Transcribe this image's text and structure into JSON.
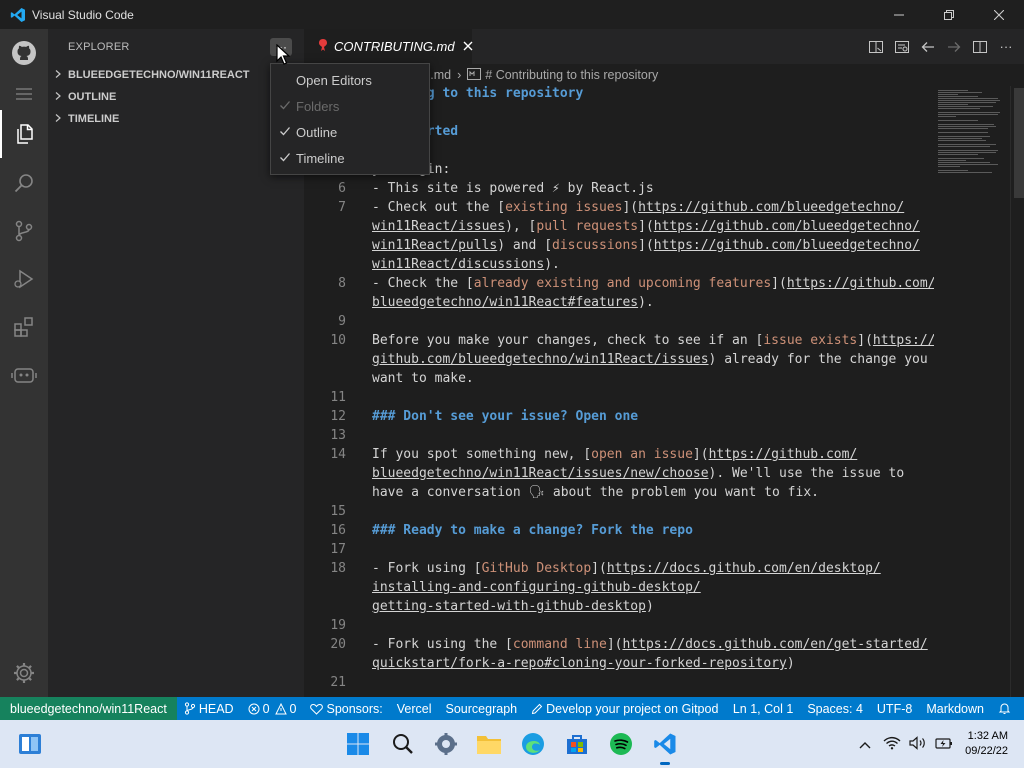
{
  "window": {
    "title": "Visual Studio Code",
    "controls": [
      "minimize",
      "restore",
      "close"
    ]
  },
  "sidebar": {
    "header": "EXPLORER",
    "sections": [
      {
        "label": "BLUEEDGETECHNO/WIN11REACT"
      },
      {
        "label": "OUTLINE"
      },
      {
        "label": "TIMELINE"
      }
    ]
  },
  "context_menu": {
    "items": [
      {
        "label": "Open Editors",
        "checked": false,
        "enabled": true
      },
      {
        "label": "Folders",
        "checked": true,
        "enabled": false
      },
      {
        "label": "Outline",
        "checked": true,
        "enabled": true
      },
      {
        "label": "Timeline",
        "checked": true,
        "enabled": true
      }
    ]
  },
  "tab": {
    "label": "CONTRIBUTING.md"
  },
  "breadcrumb": {
    "file": "s.md",
    "separator": "›",
    "symbol": "# Contributing to this repository"
  },
  "editor": {
    "lines": [
      {
        "n": "",
        "text": "ributing to this repository"
      },
      {
        "n": "",
        "text": "ing started"
      },
      {
        "n": "",
        "text": "you begin:"
      },
      {
        "n": "6",
        "text": "- This site is powered ⚡ by React.js"
      },
      {
        "n": "7",
        "a": "- Check out the [",
        "b": "existing issues",
        "c": "](",
        "d": "https://github.com/blueedgetechno/",
        "e": ""
      },
      {
        "n": "",
        "a": "",
        "b": "",
        "c": "",
        "d": "win11React/issues",
        "e": "), ["
      },
      {
        "n": "",
        "text": "win11React/pulls) and [discussions](https://github.com/blueedgetechno/"
      },
      {
        "n": "",
        "text": "win11React/discussions)."
      },
      {
        "n": "8",
        "text": "- Check the [already existing and upcoming features](https://github.com/"
      },
      {
        "n": "",
        "text": "blueedgetechno/win11React#features)."
      },
      {
        "n": "9",
        "text": ""
      },
      {
        "n": "10",
        "text": "Before you make your changes, check to see if an [issue exists](https://"
      },
      {
        "n": "",
        "text": "github.com/blueedgetechno/win11React/issues) already for the change you"
      },
      {
        "n": "",
        "text": "want to make."
      },
      {
        "n": "11",
        "text": ""
      },
      {
        "n": "12",
        "text": "### Don't see your issue? Open one"
      },
      {
        "n": "13",
        "text": ""
      },
      {
        "n": "14",
        "text": "If you spot something new, [open an issue](https://github.com/"
      },
      {
        "n": "",
        "text": "blueedgetechno/win11React/issues/new/choose). We'll use the issue to"
      },
      {
        "n": "",
        "text": "have a conversation 🗣 about the problem you want to fix."
      },
      {
        "n": "15",
        "text": ""
      },
      {
        "n": "16",
        "text": "### Ready to make a change? Fork the repo"
      },
      {
        "n": "17",
        "text": ""
      },
      {
        "n": "18",
        "text": "- Fork using [GitHub Desktop](https://docs.github.com/en/desktop/"
      },
      {
        "n": "",
        "text": "installing-and-configuring-github-desktop/"
      },
      {
        "n": "",
        "text": "getting-started-with-github-desktop)"
      },
      {
        "n": "19",
        "text": ""
      },
      {
        "n": "20",
        "text": "- Fork using the [command line](https://docs.github.com/en/get-started/"
      },
      {
        "n": "",
        "text": "quickstart/fork-a-repo#cloning-your-forked-repository)"
      },
      {
        "n": "21",
        "text": ""
      }
    ],
    "seg": {
      "l1": "ributing to this repository",
      "l2": "ing started",
      "l3": "you begin:",
      "l6": "- This site is powered ⚡ by React.js",
      "l7a_1": "- Check out the [",
      "l7a_2": "existing issues",
      "l7a_3": "](",
      "l7a_4": "https://github.com/blueedgetechno/",
      "l7b_1": "win11React/issues",
      "l7b_2": "), [",
      "l7b_3": "pull requests",
      "l7b_4": "](",
      "l7b_5": "https://github.com/blueedgetechno/",
      "l7c_1": "win11React/pulls",
      "l7c_2": ") and [",
      "l7c_3": "discussions",
      "l7c_4": "](",
      "l7c_5": "https://github.com/blueedgetechno/",
      "l7d_1": "win11React/discussions",
      "l7d_2": ").",
      "l8a_1": "- Check the [",
      "l8a_2": "already existing and upcoming features",
      "l8a_3": "](",
      "l8a_4": "https://github.com/",
      "l8b_1": "blueedgetechno/win11React#features",
      "l8b_2": ").",
      "l10a_1": "Before you make your changes, check to see if an [",
      "l10a_2": "issue exists",
      "l10a_3": "](",
      "l10a_4": "https://",
      "l10b_1": "github.com/blueedgetechno/win11React/issues",
      "l10b_2": ") already for the change you",
      "l10c": "want to make.",
      "l12": "### Don't see your issue? Open one",
      "l14a_1": "If you spot something new, [",
      "l14a_2": "open an issue",
      "l14a_3": "](",
      "l14a_4": "https://github.com/",
      "l14b_1": "blueedgetechno/win11React/issues/new/choose",
      "l14b_2": "). We'll use the issue to",
      "l14c": "have a conversation 🗣 about the problem you want to fix.",
      "l16": "### Ready to make a change? Fork the repo",
      "l18a_1": "- Fork using [",
      "l18a_2": "GitHub Desktop",
      "l18a_3": "](",
      "l18a_4": "https://docs.github.com/en/desktop/",
      "l18b": "installing-and-configuring-github-desktop/",
      "l18c_1": "getting-started-with-github-desktop",
      "l18c_2": ")",
      "l20a_1": "- Fork using the [",
      "l20a_2": "command line",
      "l20a_3": "](",
      "l20a_4": "https://docs.github.com/en/get-started/",
      "l20b_1": "quickstart/fork-a-repo#cloning-your-forked-repository",
      "l20b_2": ")"
    }
  },
  "statusbar": {
    "remote": "blueedgetechno/win11React",
    "branch": "HEAD",
    "errors": "0",
    "warnings": "0",
    "sponsors": "Sponsors:",
    "vercel": "Vercel",
    "sourcegraph": "Sourcegraph",
    "gitpod": "Develop your project on Gitpod",
    "position": "Ln 1, Col 1",
    "spaces": "Spaces: 4",
    "encoding": "UTF-8",
    "language": "Markdown"
  },
  "taskbar": {
    "time": "1:32 AM",
    "date": "09/22/22"
  },
  "colors": {
    "statusbar": "#007acc",
    "remote": "#16825d",
    "heading": "#569cd6",
    "link_text": "#ce9178"
  }
}
